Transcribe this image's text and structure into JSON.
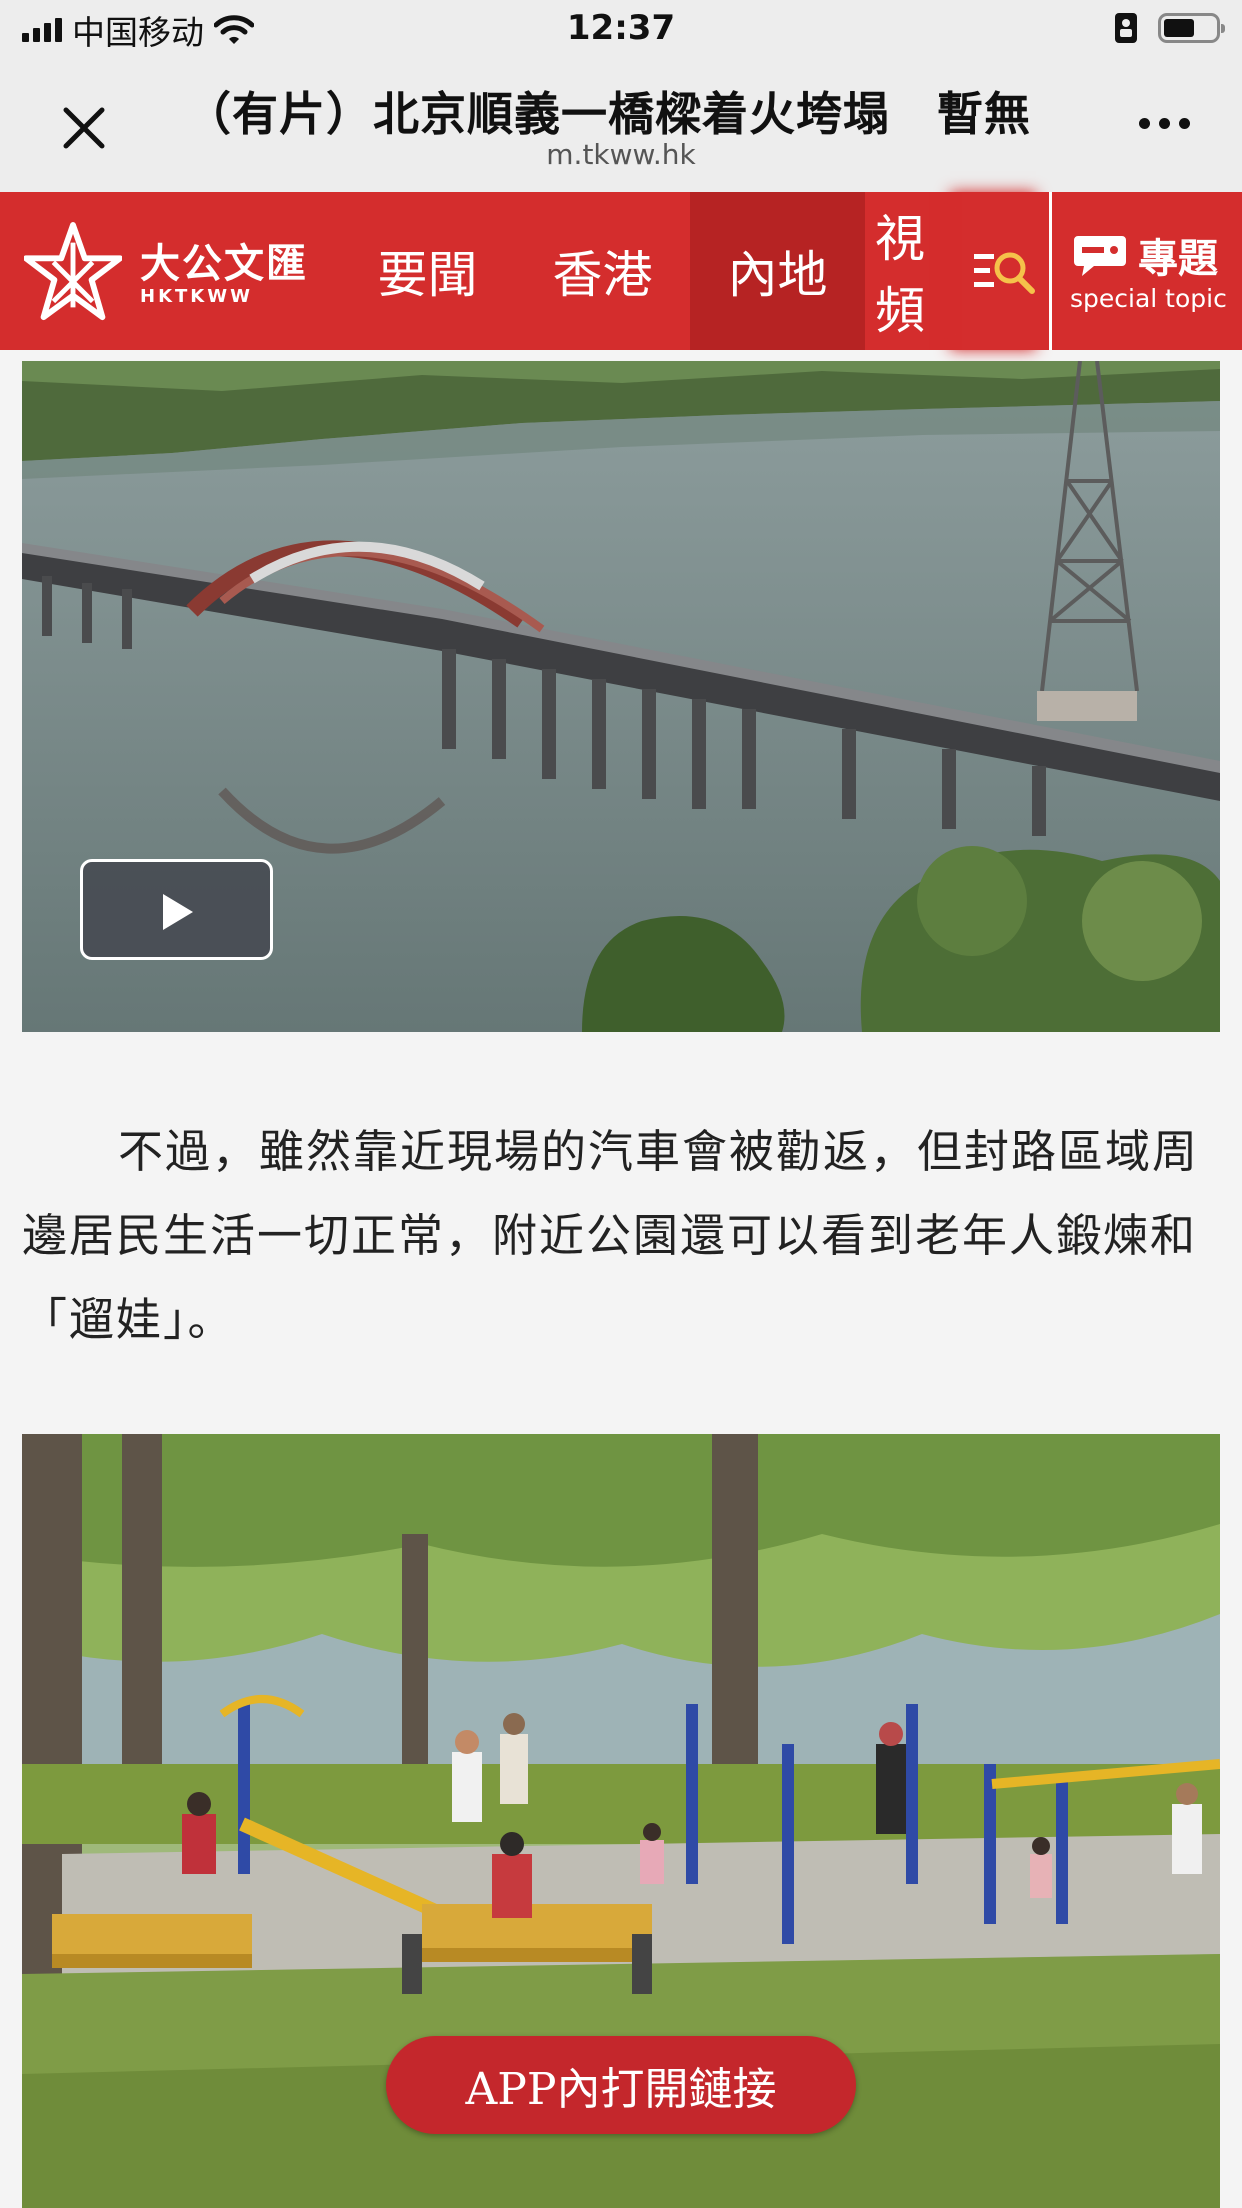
{
  "status_bar": {
    "carrier": "中国移动",
    "time": "12:37"
  },
  "title_bar": {
    "title": "（有片）北京順義一橋樑着火垮塌　暫無",
    "url": "m.tkww.hk"
  },
  "site_nav": {
    "logo_cn": "大公文匯",
    "logo_en": "HKTKWW",
    "items": [
      {
        "label": "要聞",
        "active": false
      },
      {
        "label": "香港",
        "active": false
      },
      {
        "label": "內地",
        "active": true
      },
      {
        "label": "視頻",
        "active": false
      }
    ],
    "special_cn": "專題",
    "special_en": "special topic"
  },
  "article": {
    "paragraph": "不過，雖然靠近現場的汽車會被勸返，但封路區域周邊居民生活一切正常，附近公園還可以看到老年人鍛煉和「遛娃」。"
  },
  "open_in_app": "APP內打開鏈接",
  "colors": {
    "brand_red": "#d42d2d",
    "active_nav": "#b62323",
    "app_button": "#c4272c"
  },
  "icons": {
    "close": "close-icon",
    "more": "more-icon",
    "search": "search-icon",
    "special": "chat-bubble-icon",
    "play": "play-icon"
  }
}
